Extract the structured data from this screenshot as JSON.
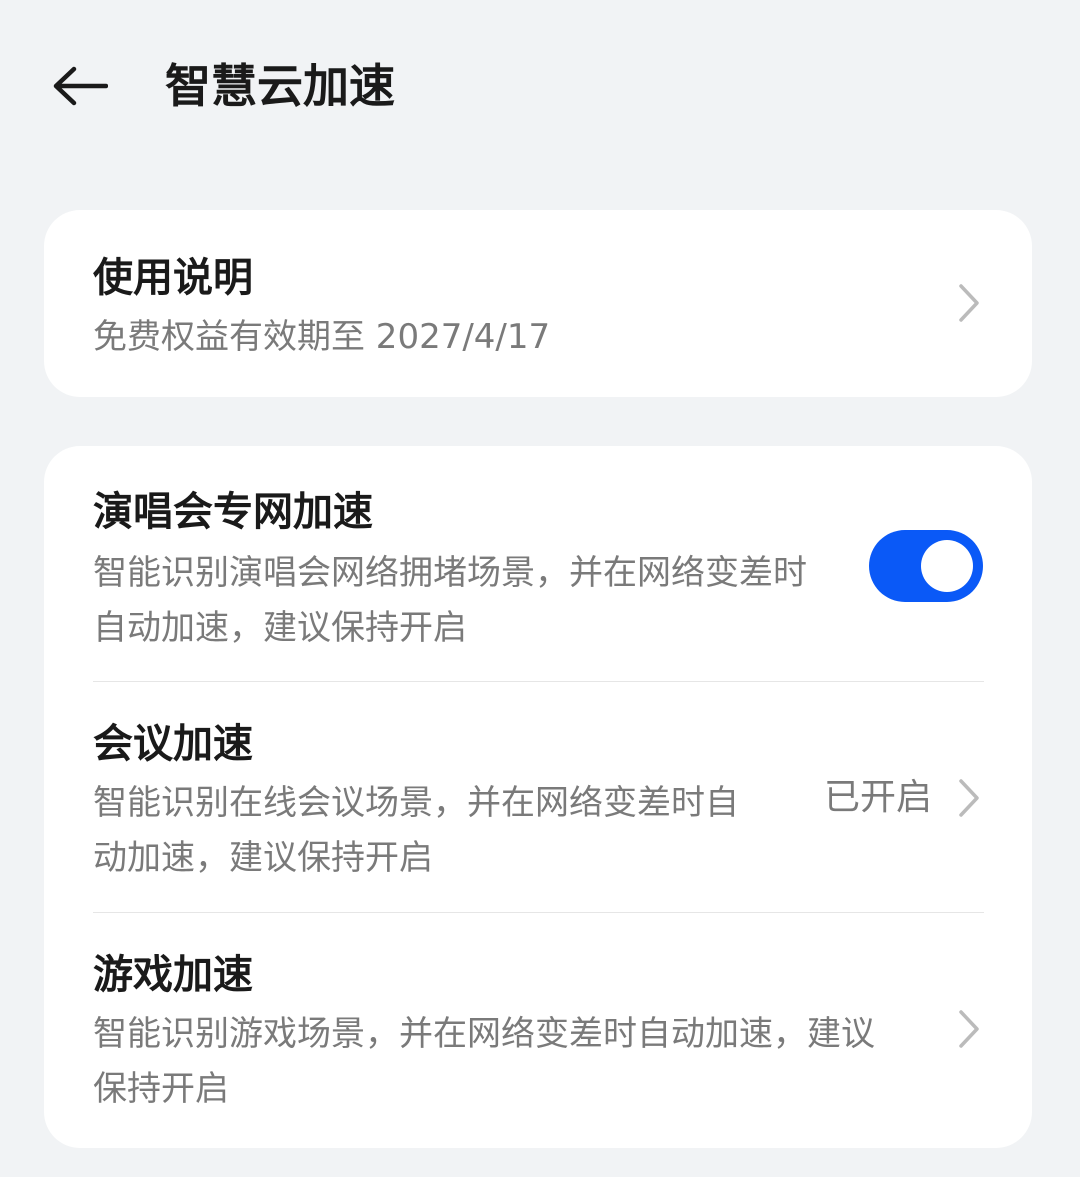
{
  "header": {
    "title": "智慧云加速",
    "back_icon": "arrow-left-icon"
  },
  "instructions": {
    "title": "使用说明",
    "subtitle": "免费权益有效期至 2027/4/17"
  },
  "concert": {
    "title": "演唱会专网加速",
    "description": "智能识别演唱会网络拥堵场景，并在网络变差时自动加速，建议保持开启",
    "enabled": true
  },
  "meeting": {
    "title": "会议加速",
    "description": "智能识别在线会议场景，并在网络变差时自动加速，建议保持开启",
    "status": "已开启"
  },
  "game": {
    "title": "游戏加速",
    "description": "智能识别游戏场景，并在网络变差时自动加速，建议保持开启"
  },
  "colors": {
    "background": "#F1F3F5",
    "card": "#FFFFFF",
    "accent": "#0A59F7",
    "secondary_text": "#7A7A7A"
  }
}
